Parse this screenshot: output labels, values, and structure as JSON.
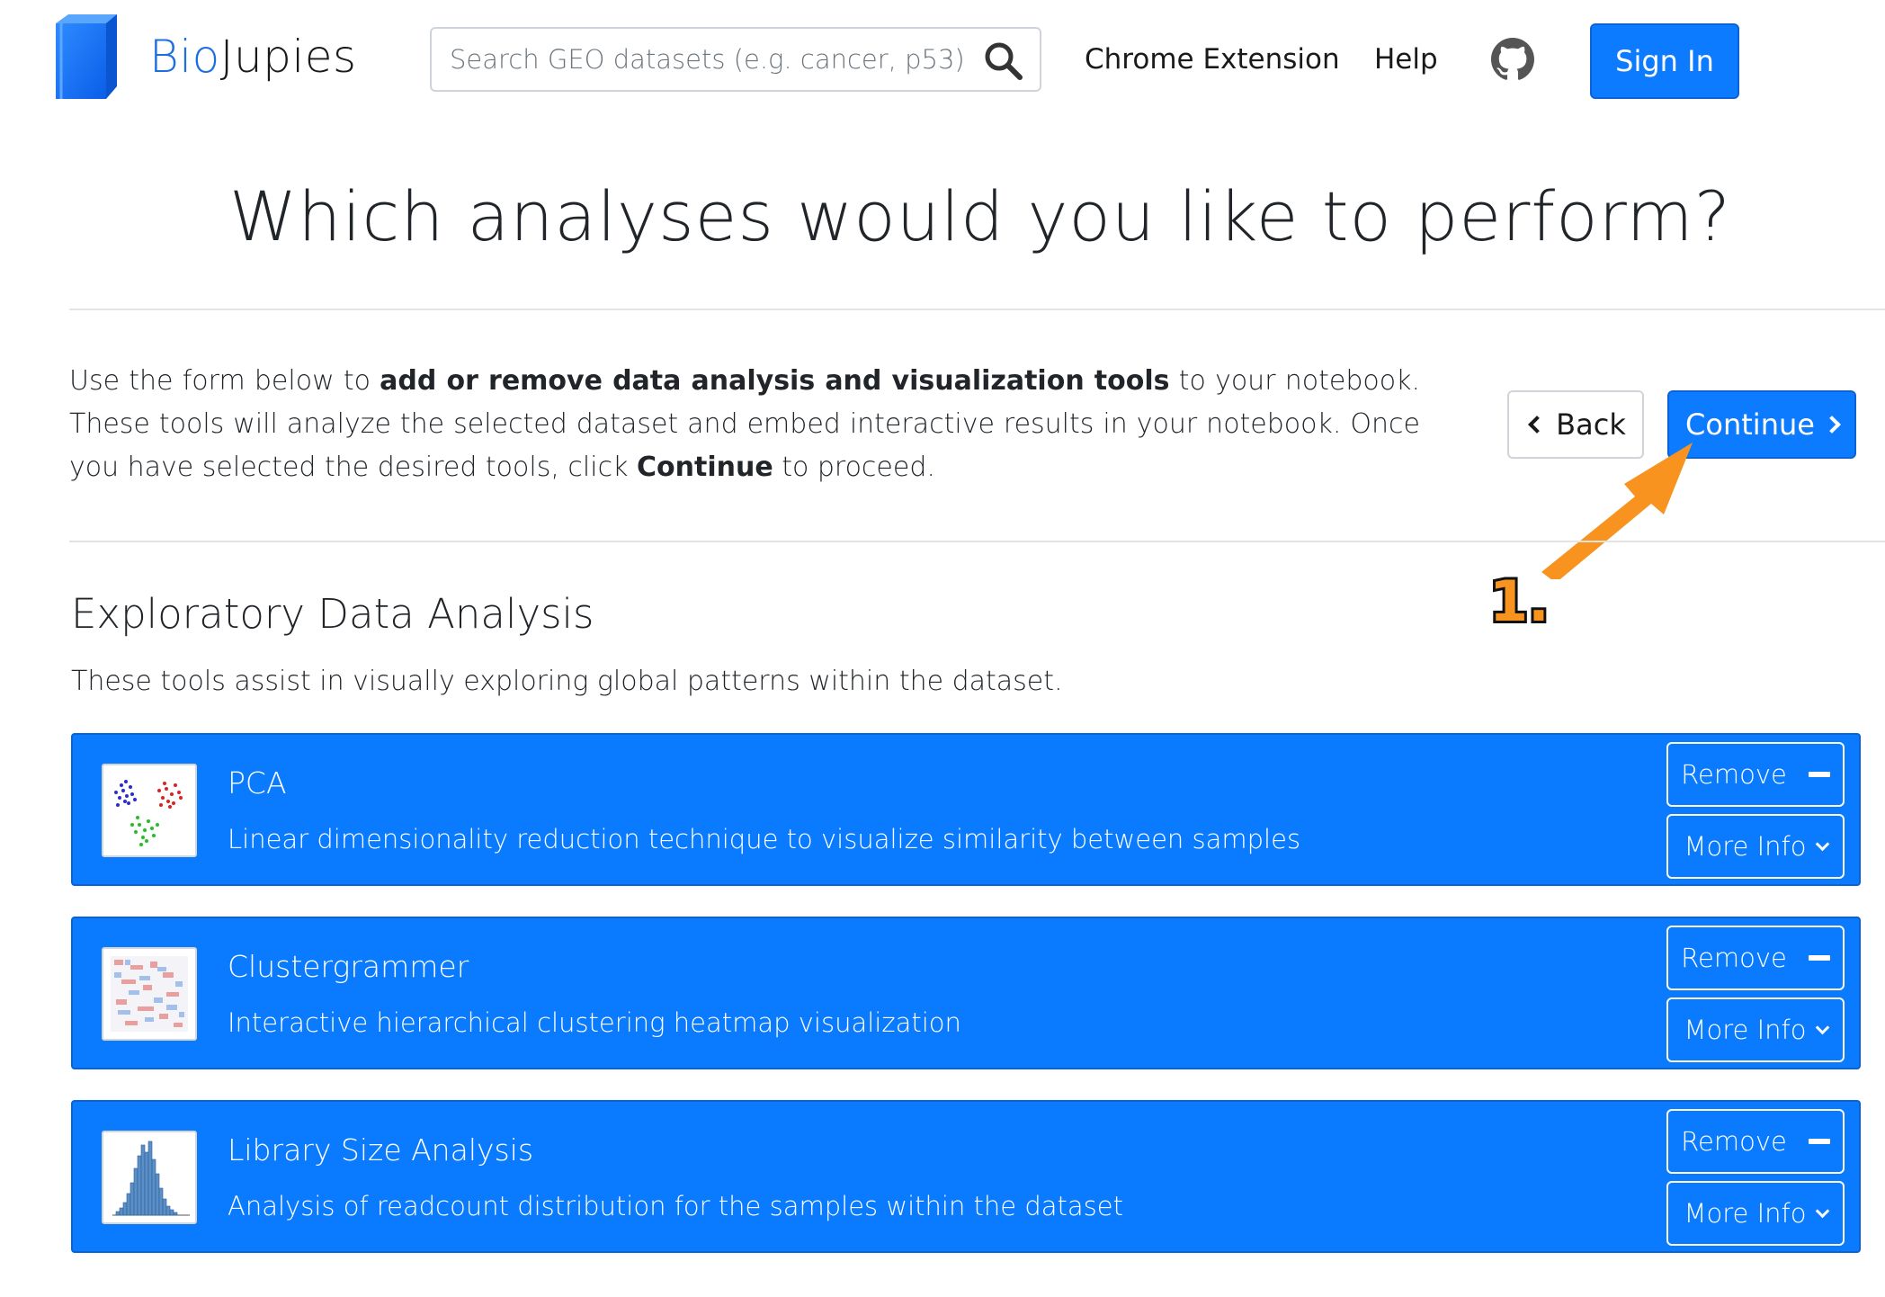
{
  "brand": {
    "name_part1": "Bio",
    "name_part2": "Jupies"
  },
  "search": {
    "placeholder": "Search GEO datasets (e.g. cancer, p53)"
  },
  "nav": {
    "chrome_extension": "Chrome Extension",
    "help": "Help",
    "sign_in": "Sign In"
  },
  "page": {
    "title": "Which analyses would you like to perform?"
  },
  "intro": {
    "text_1": "Use the form below to ",
    "bold_1": "add or remove data analysis and visualization tools",
    "text_2": " to your notebook. These tools will analyze the selected dataset and embed interactive results in your notebook. Once you have selected the desired tools, click ",
    "bold_2": "Continue",
    "text_3": " to proceed."
  },
  "buttons": {
    "back": "Back",
    "continue": "Continue"
  },
  "annotation": {
    "label": "1."
  },
  "section": {
    "title": "Exploratory Data Analysis",
    "description": "These tools assist in visually exploring global patterns within the dataset."
  },
  "tools": [
    {
      "name": "PCA",
      "description": "Linear dimensionality reduction technique to visualize similarity between samples",
      "remove_label": "Remove",
      "more_label": "More Info"
    },
    {
      "name": "Clustergrammer",
      "description": "Interactive hierarchical clustering heatmap visualization",
      "remove_label": "Remove",
      "more_label": "More Info"
    },
    {
      "name": "Library Size Analysis",
      "description": "Analysis of readcount distribution for the samples within the dataset",
      "remove_label": "Remove",
      "more_label": "More Info"
    }
  ],
  "colors": {
    "primary": "#0d7bff",
    "annotation": "#f7931e",
    "brand_blue": "#1c6fe0"
  }
}
